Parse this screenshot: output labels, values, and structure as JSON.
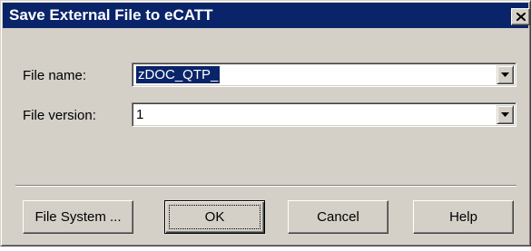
{
  "window": {
    "title": "Save External File to eCATT",
    "close_icon": "close-icon"
  },
  "form": {
    "file_name_label": "File name:",
    "file_name_value": "zDOC_QTP_",
    "file_version_label": "File version:",
    "file_version_value": "1"
  },
  "buttons": {
    "file_system": "File System ...",
    "ok": "OK",
    "cancel": "Cancel",
    "help": "Help"
  },
  "colors": {
    "title_bar": "#0a246a",
    "dialog_face": "#d4d0c8",
    "selection": "#0a246a"
  }
}
